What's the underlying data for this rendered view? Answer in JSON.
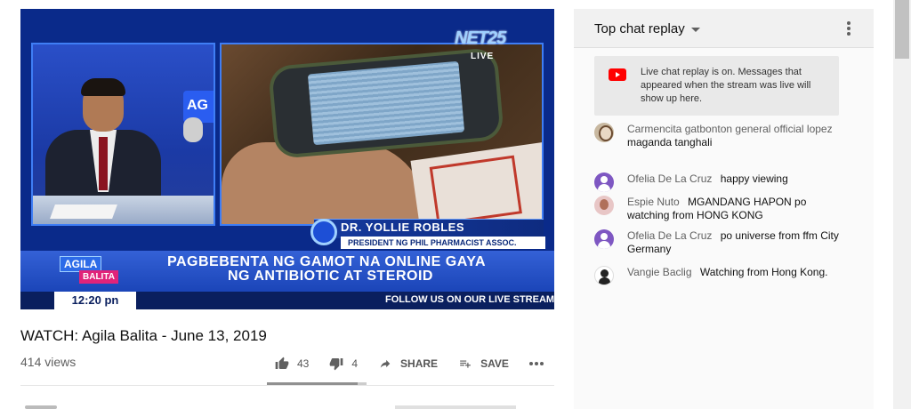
{
  "video": {
    "channel_logo": "NET25",
    "live_badge": "LIVE",
    "studio_sign": "AG",
    "guest_name": "DR. YOLLIE ROBLES",
    "guest_title": "PRESIDENT NG PHIL PHARMACIST ASSOC.",
    "headline_line1": "PAGBEBENTA NG GAMOT NA ONLINE GAYA",
    "headline_line2": "NG ANTIBIOTIC AT STEROID",
    "show_logo_line1": "AGILA",
    "show_logo_line2": "BALITA",
    "time": "12:20 pn",
    "ticker": "FOLLOW US ON OUR LIVE STREAMI"
  },
  "meta": {
    "title": "WATCH: Agila Balita - June 13, 2019",
    "views": "414 views",
    "likes": "43",
    "dislikes": "4",
    "share_label": "SHARE",
    "save_label": "SAVE",
    "like_ratio": 0.915
  },
  "chat": {
    "header_title": "Top chat replay",
    "notice": "Live chat replay is on. Messages that appeared when the stream was live will show up here.",
    "messages": [
      {
        "author": "Carmencita gatbonton general official lopez",
        "text": "maganda tanghali",
        "avatar": "photo"
      },
      {
        "author": "Ofelia De La Cruz",
        "text": "happy viewing",
        "avatar": "default"
      },
      {
        "author": "Espie Nuto",
        "text": "MGANDANG HAPON po watching from HONG KONG",
        "avatar": "photo"
      },
      {
        "author": "Ofelia De La Cruz",
        "text": "po universe from ffm City Germany",
        "avatar": "default"
      },
      {
        "author": "Vangie Baclig",
        "text": "Watching from Hong Kong.",
        "avatar": "photo"
      }
    ]
  },
  "icons": {
    "like": "thumbs-up-icon",
    "dislike": "thumbs-down-icon",
    "share": "share-arrow-icon",
    "save": "playlist-add-icon",
    "more": "more-horiz-icon",
    "dropdown": "caret-down-icon",
    "menu": "more-vert-icon",
    "youtube": "youtube-logo-icon"
  },
  "colors": {
    "accent_red": "#ff0000",
    "news_blue": "#1b45b8"
  }
}
